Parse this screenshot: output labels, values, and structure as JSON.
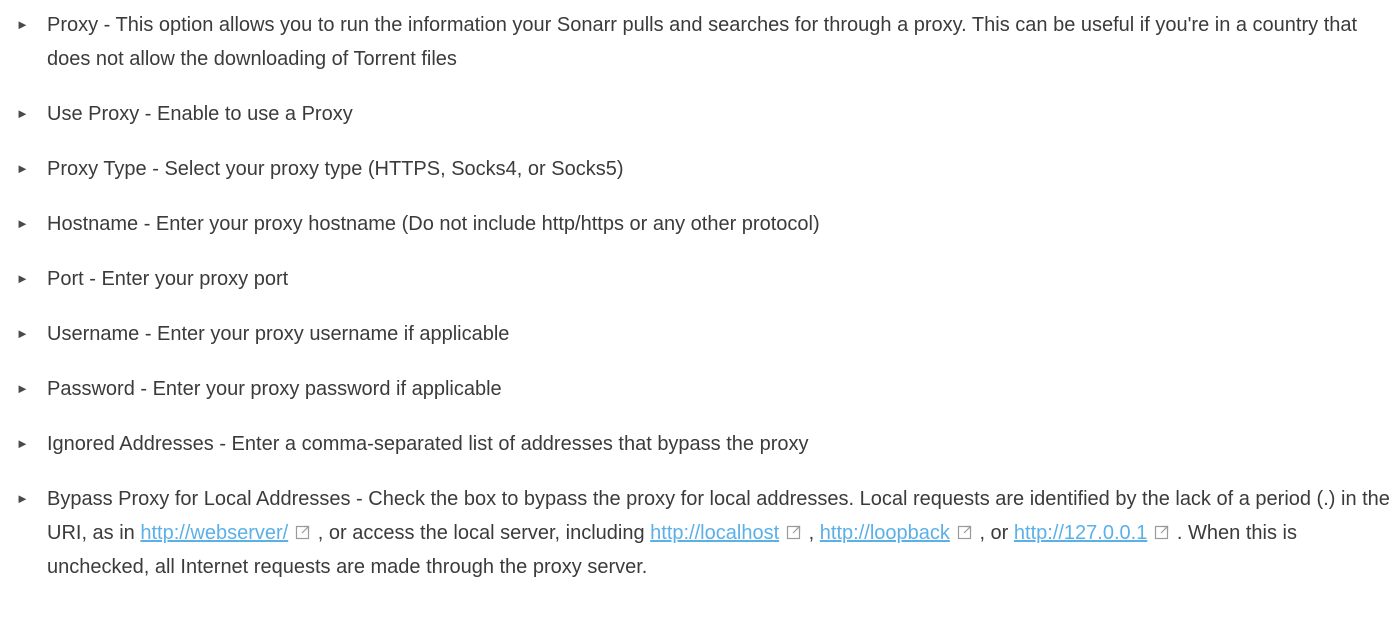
{
  "items": [
    {
      "text": "Proxy - This option allows you to run the information your Sonarr pulls and searches for through a proxy. This can be useful if you're in a country that does not allow the downloading of Torrent files"
    },
    {
      "text": "Use Proxy - Enable to use a Proxy"
    },
    {
      "text": "Proxy Type - Select your proxy type (HTTPS, Socks4, or Socks5)"
    },
    {
      "text": "Hostname - Enter your proxy hostname (Do not include http/https or any other protocol)"
    },
    {
      "text": "Port - Enter your proxy port"
    },
    {
      "text": "Username - Enter your proxy username if applicable"
    },
    {
      "text": "Password - Enter your proxy password if applicable"
    },
    {
      "text": "Ignored Addresses - Enter a comma-separated list of addresses that bypass the proxy"
    }
  ],
  "bypass": {
    "text_before": "Bypass Proxy for Local Addresses - Check the box to bypass the proxy for local addresses. Local requests are identified by the lack of a period (.) in the URI, as in ",
    "link_webserver": "http://webserver/",
    "text_mid1": " , or access the local server, including ",
    "link_localhost": "http://localhost",
    "sep1": " , ",
    "link_loopback": "http://loopback",
    "sep2": " , or ",
    "link_127": "http://127.0.0.1",
    "text_after": " . When this is unchecked, all Internet requests are made through the proxy server."
  },
  "bullet_glyph": "►",
  "icons": {
    "external_link": "external-link-icon"
  },
  "colors": {
    "text": "#3b3b3b",
    "link": "#5bb0e8",
    "icon": "#9a9a9a"
  }
}
